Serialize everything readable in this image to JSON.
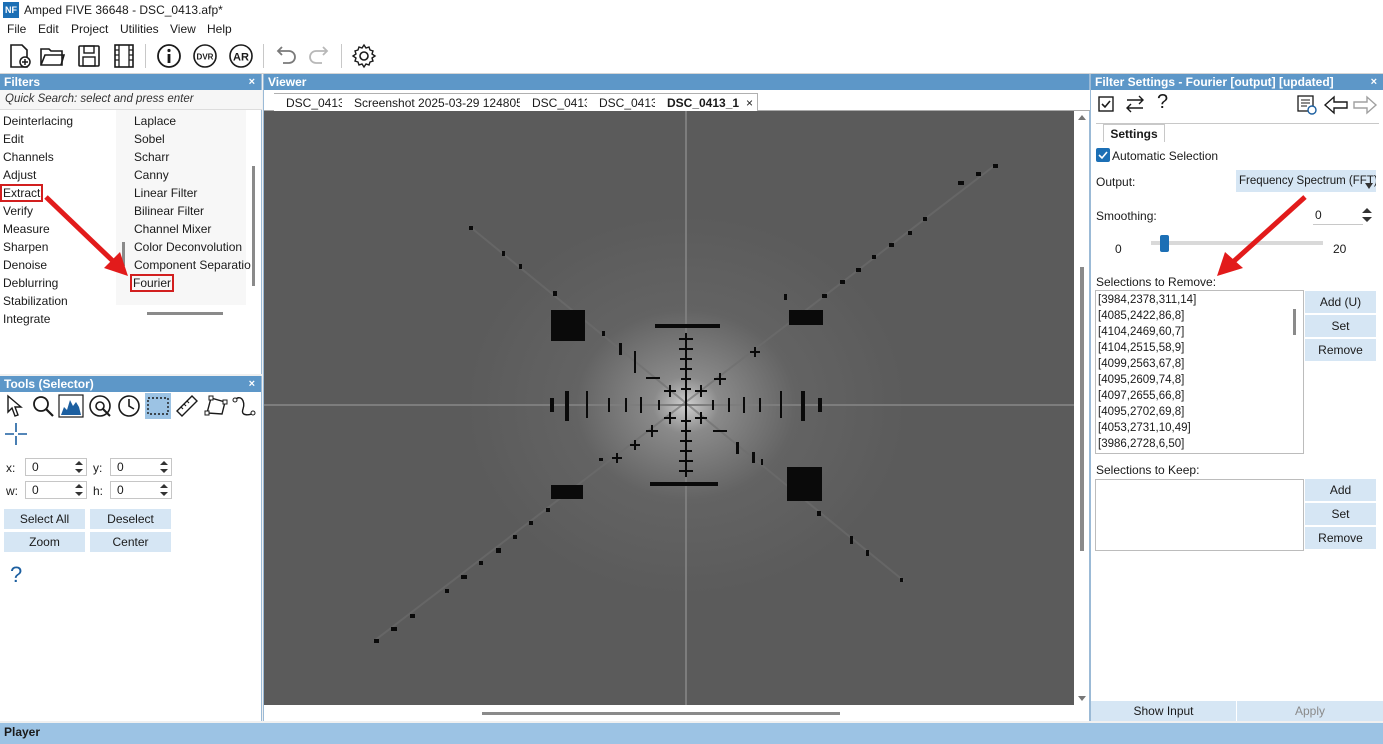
{
  "window": {
    "title": "Amped FIVE 36648 - DSC_0413.afp*",
    "logo": "NF"
  },
  "menu": [
    "File",
    "Edit",
    "Project",
    "Utilities",
    "View",
    "Help"
  ],
  "toolbar": {
    "icons": [
      "new-project-icon",
      "open-icon",
      "save-icon",
      "film-icon",
      "info-icon",
      "dvr-icon",
      "ar-icon",
      "undo-icon",
      "redo-icon",
      "settings-gear-icon"
    ],
    "dvr": "DVR",
    "ar": "AR"
  },
  "filters": {
    "title": "Filters",
    "close": "×",
    "search_placeholder": "Quick Search: select and press enter",
    "categories": [
      "Deinterlacing",
      "Edit",
      "Channels",
      "Adjust",
      "Extract",
      "Verify",
      "Measure",
      "Sharpen",
      "Denoise",
      "Deblurring",
      "Stabilization",
      "Integrate"
    ],
    "items": [
      "Laplace",
      "Sobel",
      "Scharr",
      "Canny",
      "Linear Filter",
      "Bilinear Filter",
      "Channel Mixer",
      "Color Deconvolution",
      "Component Separatio",
      "Fourier"
    ]
  },
  "tools": {
    "title": "Tools (Selector)",
    "close": "×",
    "x_label": "x:",
    "x_value": "0",
    "y_label": "y:",
    "y_value": "0",
    "w_label": "w:",
    "w_value": "0",
    "h_label": "h:",
    "h_value": "0",
    "select_all": "Select All",
    "deselect": "Deselect",
    "zoom": "Zoom",
    "center": "Center",
    "help": "?"
  },
  "viewer": {
    "title": "Viewer",
    "tabs": [
      "DSC_0413",
      "Screenshot 2025-03-29 124805",
      "DSC_0413",
      "DSC_0413",
      "DSC_0413_1"
    ],
    "active_tab_close": "×"
  },
  "filter_settings": {
    "title": "Filter Settings - Fourier [output] [updated]",
    "close": "×",
    "help": "?",
    "settings_tab": "Settings",
    "automatic_selection": "Automatic Selection",
    "automatic_selection_checked": true,
    "output_label": "Output:",
    "output_value": "Frequency Spectrum (FFT)",
    "smoothing_label": "Smoothing:",
    "smoothing_value": "0",
    "slider_min": "0",
    "slider_max": "20",
    "slider_level": 0.05,
    "remove_label": "Selections to Remove:",
    "remove_items": [
      "[3984,2378,311,14]",
      "[4085,2422,86,8]",
      "[4104,2469,60,7]",
      "[4104,2515,58,9]",
      "[4099,2563,67,8]",
      "[4095,2609,74,8]",
      "[4097,2655,66,8]",
      "[4095,2702,69,8]",
      "[4053,2731,10,49]",
      "[3986,2728,6,50]"
    ],
    "add_u": "Add (U)",
    "set": "Set",
    "remove": "Remove",
    "keep_label": "Selections to Keep:",
    "add": "Add",
    "show_input": "Show Input",
    "apply": "Apply"
  },
  "player": {
    "title": "Player"
  },
  "colors": {
    "accent": "#5d97c8",
    "highlight": "#d21f1f",
    "button": "#d6e6f4"
  }
}
